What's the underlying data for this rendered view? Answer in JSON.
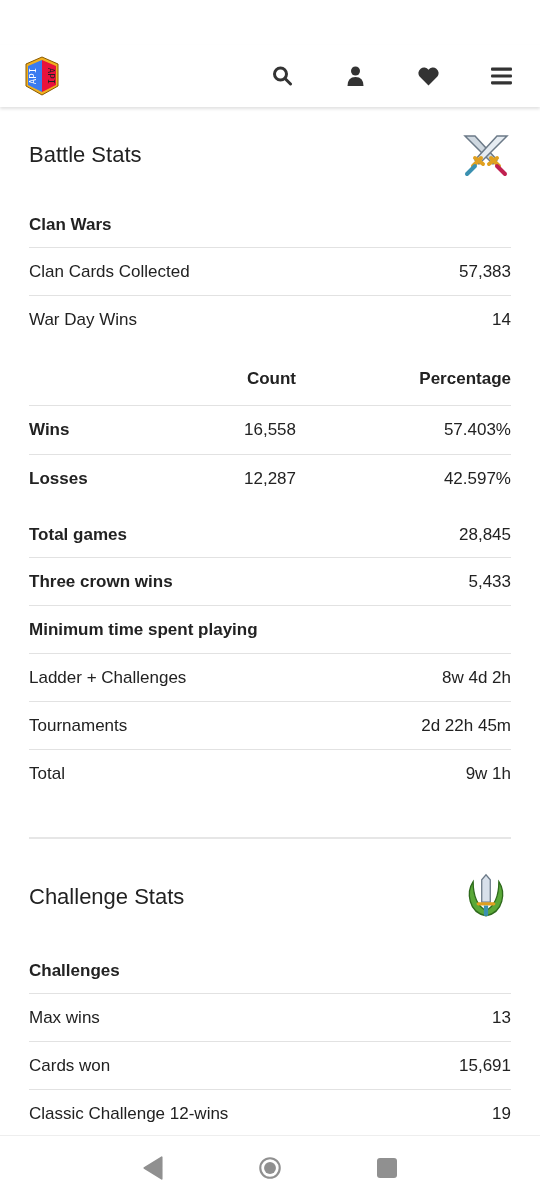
{
  "logo": {
    "text": [
      "API",
      "API"
    ]
  },
  "nav_icons": [
    {
      "kind": "search"
    },
    {
      "kind": "user"
    },
    {
      "kind": "heart"
    },
    {
      "kind": "menu"
    }
  ],
  "sections": [
    {
      "title": "Battle Stats",
      "groups": [
        {
          "rows": [
            {
              "kind": "subheading",
              "label": "Clan Wars"
            },
            {
              "kind": "stat",
              "label": "Clan Cards Collected",
              "value": "57,383",
              "bold": false
            },
            {
              "kind": "stat",
              "label": "War Day Wins",
              "value": "14",
              "bold": false
            }
          ]
        },
        {
          "rows": [
            {
              "kind": "table",
              "columns": [
                "Count",
                "Percentage"
              ],
              "rows": [
                {
                  "label": "Wins",
                  "count": "16,558",
                  "percentage": "57.403%"
                },
                {
                  "label": "Losses",
                  "count": "12,287",
                  "percentage": "42.597%"
                }
              ]
            }
          ]
        },
        {
          "rows": [
            {
              "kind": "stat",
              "label": "Total games",
              "value": "28,845",
              "bold": true
            },
            {
              "kind": "stat",
              "label": "Three crown wins",
              "value": "5,433",
              "bold": true
            },
            {
              "kind": "subheading",
              "label": "Minimum time spent playing"
            },
            {
              "kind": "stat",
              "label": "Ladder + Challenges",
              "value": "8w 4d 2h",
              "bold": false
            },
            {
              "kind": "stat",
              "label": "Tournaments",
              "value": "2d 22h 45m",
              "bold": false
            },
            {
              "kind": "stat",
              "label": "Total",
              "value": "9w 1h",
              "bold": false
            }
          ]
        }
      ]
    },
    {
      "title": "Challenge Stats",
      "groups": [
        {
          "rows": [
            {
              "kind": "subheading",
              "label": "Challenges"
            },
            {
              "kind": "stat",
              "label": "Max wins",
              "value": "13",
              "bold": false
            },
            {
              "kind": "stat",
              "label": "Cards won",
              "value": "15,691",
              "bold": false
            },
            {
              "kind": "stat",
              "label": "Classic Challenge 12-wins",
              "value": "19",
              "bold": false
            }
          ]
        }
      ]
    }
  ]
}
